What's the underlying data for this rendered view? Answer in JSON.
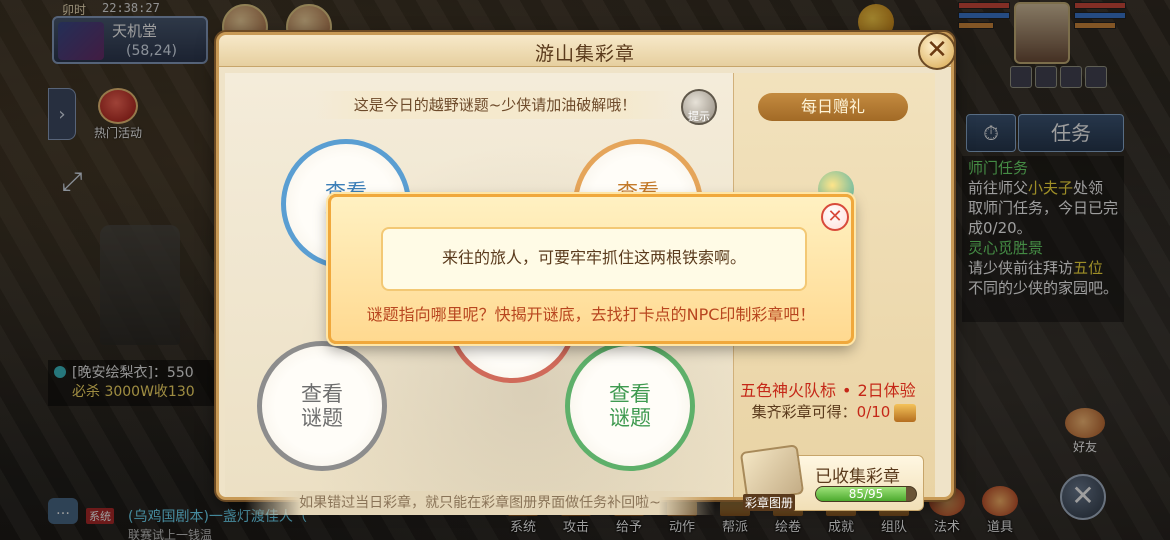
{
  "hud": {
    "time_period": "卯时",
    "clock": "22:38:27",
    "location_name": "天机堂",
    "location_coord": "(58,24)",
    "hot_activity_label": "热门活动"
  },
  "chat": {
    "line1": "[晚安绘梨衣]：550",
    "line2": "必杀 3000W收130",
    "system_tag": "系统",
    "system_message": "(乌鸡国剧本)一盏灯渡佳人（",
    "system_message2": "联赛试上一钱温"
  },
  "right_hud": {
    "task_tab_label": "任务",
    "tasks": [
      {
        "title": "师门任务",
        "body_pre": "前往师父",
        "highlight": "小夫子",
        "body_post": "处领取师门任务，今日已完成0/20。"
      },
      {
        "title": "灵心觅胜景",
        "body_pre": "请少侠前往拜访",
        "highlight": "五位",
        "body_post": "不同的少侠的家园吧。"
      }
    ],
    "friend_label": "好友"
  },
  "bottom_menu": {
    "items": [
      "系统",
      "攻击",
      "给予",
      "动作",
      "帮派",
      "绘卷",
      "成就",
      "组队",
      "法术",
      "道具"
    ]
  },
  "panel": {
    "title": "游山集彩章",
    "hint_text": "这是今日的越野谜题~少侠请加油破解哦！",
    "hint_button": "提示",
    "riddles": {
      "label_line1": "查看",
      "label_line2": "谜题"
    },
    "footer_tip": "如果错过当日彩章，就只能在彩章图册界面做任务补回啦~",
    "daily_gift_title": "每日赠礼",
    "reward_name": "五色神火队标",
    "reward_duration": "2日体验",
    "collect_label": "集齐彩章可得：",
    "collect_count": "0/10",
    "collected_title": "已收集彩章",
    "collected_progress_text": "85/95",
    "collected_progress_fraction": 0.895,
    "album_label": "彩章图册"
  },
  "modal": {
    "message": "来往的旅人，可要牢牢抓住这两根铁索啊。",
    "sub_message": "谜题指向哪里呢？快揭开谜底，去找打卡点的NPC印制彩章吧！"
  }
}
